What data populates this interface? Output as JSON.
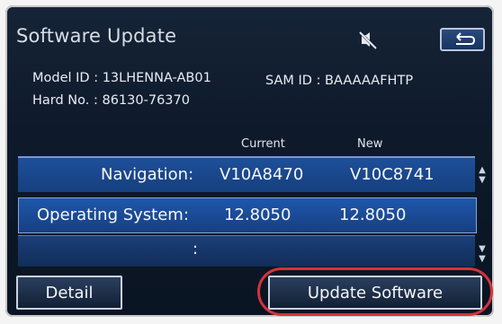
{
  "header": {
    "title": "Software Update",
    "mute_icon": "mute-icon",
    "back_icon": "back-arrow-icon"
  },
  "info": {
    "model_id": "Model ID : 13LHENNA-AB01",
    "hard_no": "Hard No. : 86130-76370",
    "sam_id": "SAM ID : BAAAAAFHTP"
  },
  "table": {
    "headers": {
      "current": "Current",
      "new": "New"
    },
    "rows": [
      {
        "label": "Navigation:",
        "current": "V10A8470",
        "new": "V10C8741"
      },
      {
        "label": "Operating System:",
        "current": "12.8050",
        "new": "12.8050"
      },
      {
        "label": ":",
        "current": "",
        "new": ""
      }
    ]
  },
  "buttons": {
    "detail": "Detail",
    "update": "Update Software"
  },
  "colors": {
    "highlight": "#d5333b",
    "row_blue": "#1e57ab"
  }
}
